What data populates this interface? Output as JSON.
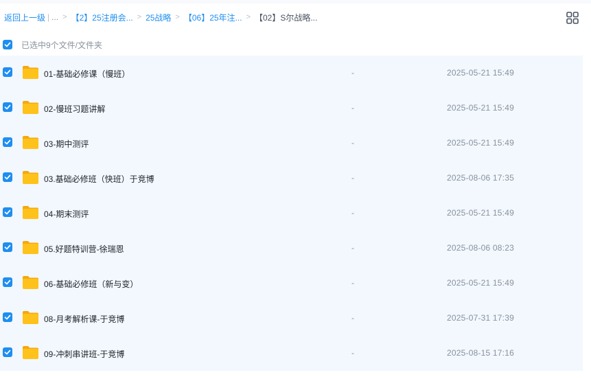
{
  "breadcrumb": {
    "back": "返回上一级",
    "ellipsis": "...",
    "items": [
      "【2】25注册会...",
      "25战略",
      "【06】25年注...",
      "【02】S尔战略..."
    ]
  },
  "icons": {
    "view_toggle": "grid-view-icon",
    "folder": "folder-icon",
    "check": "checkbox-checked-icon"
  },
  "colors": {
    "accent": "#1f8ef0",
    "row_bg": "#f2f8fe",
    "folder": "#ffc21a"
  },
  "selection": {
    "summary": "已选中9个文件/文件夹"
  },
  "files": [
    {
      "name": "01-基础必修课（慢班）",
      "size": "-",
      "mtime": "2025-05-21 15:49"
    },
    {
      "name": "02-慢班习题讲解",
      "size": "-",
      "mtime": "2025-05-21 15:49"
    },
    {
      "name": "03-期中测评",
      "size": "-",
      "mtime": "2025-05-21 15:49"
    },
    {
      "name": "03.基础必修班（快班）于竞博",
      "size": "-",
      "mtime": "2025-08-06 17:35"
    },
    {
      "name": "04-期末测评",
      "size": "-",
      "mtime": "2025-05-21 15:49"
    },
    {
      "name": "05.好题特训营-徐瑞恩",
      "size": "-",
      "mtime": "2025-08-06 08:23"
    },
    {
      "name": "06-基础必修班（新与变）",
      "size": "-",
      "mtime": "2025-05-21 15:49"
    },
    {
      "name": "08-月考解析课-于竞博",
      "size": "-",
      "mtime": "2025-07-31 17:39"
    },
    {
      "name": "09-冲刺串讲班-于竞博",
      "size": "-",
      "mtime": "2025-08-15 17:16"
    }
  ]
}
